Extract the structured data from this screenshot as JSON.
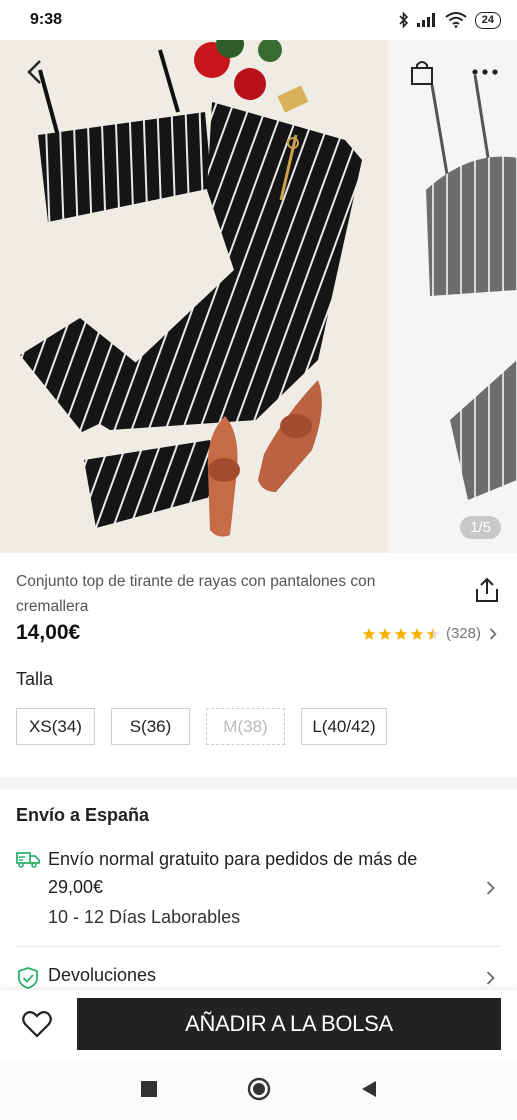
{
  "status": {
    "time": "9:38",
    "battery": "24"
  },
  "gallery": {
    "pager": "1/5"
  },
  "product": {
    "title": "Conjunto top de tirante de rayas con pantalones con cremallera",
    "price": "14,00€",
    "rating_stars": 4.5,
    "review_count": "(328)"
  },
  "size_section": {
    "label": "Talla",
    "options": [
      {
        "label": "XS(34)",
        "available": true
      },
      {
        "label": "S(36)",
        "available": true
      },
      {
        "label": "M(38)",
        "available": false
      },
      {
        "label": "L(40/42)",
        "available": true
      }
    ]
  },
  "shipping": {
    "title": "Envío a España",
    "normal_text": "Envío normal gratuito para pedidos de más de 29,00€",
    "days": "10 - 12 Días Laborables",
    "returns": "Devoluciones"
  },
  "actions": {
    "add_to_bag": "AÑADIR A LA BOLSA"
  },
  "colors": {
    "star": "#f5b400",
    "ship_icon": "#2db36b",
    "button": "#222222"
  },
  "icons": [
    "back-icon",
    "bag-icon",
    "more-icon",
    "share-icon",
    "star-icon",
    "truck-icon",
    "shield-icon",
    "heart-icon",
    "chevron-right-icon"
  ]
}
